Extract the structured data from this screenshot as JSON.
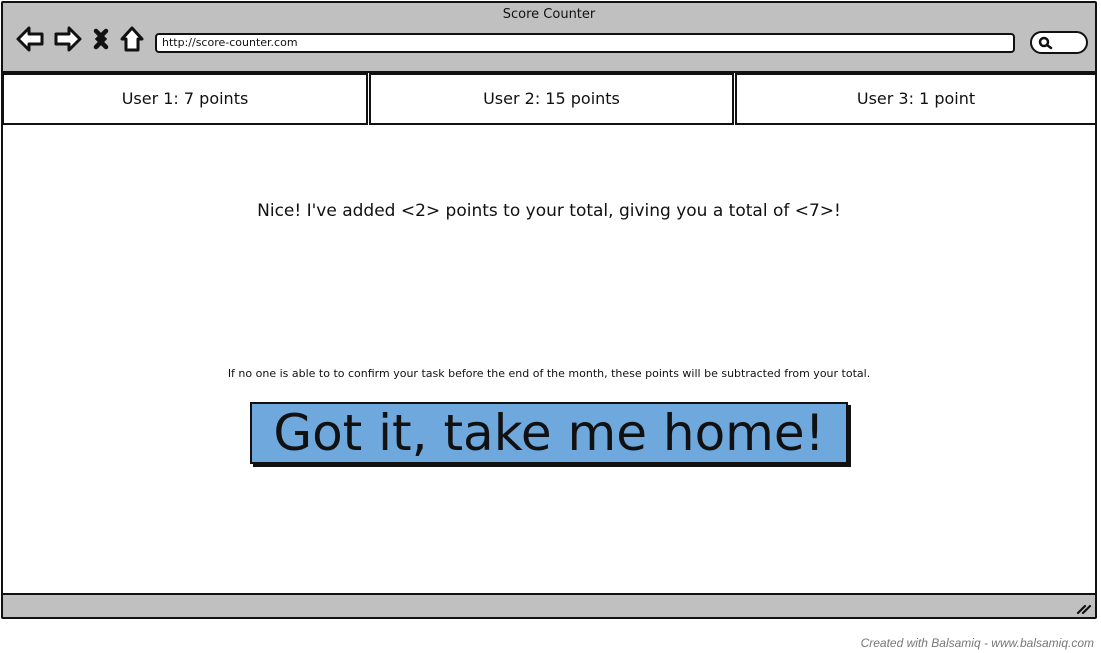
{
  "window": {
    "title": "Score Counter",
    "url": "http://score-counter.com"
  },
  "nav_icons": [
    "back-arrow-icon",
    "forward-arrow-icon",
    "close-icon",
    "home-icon"
  ],
  "search_icon": "search-icon",
  "tabs": [
    {
      "label": "User 1: 7 points"
    },
    {
      "label": "User 2: 15 points"
    },
    {
      "label": "User 3: 1 point"
    }
  ],
  "main": {
    "message": "Nice! I've added <2> points to your total, giving you a total of <7>!",
    "note": "If no one is able to to confirm your task before the end of the month, these points will be subtracted from your total.",
    "button_label": "Got it, take me home!"
  },
  "footer": {
    "credit": "Created with Balsamiq - www.balsamiq.com"
  },
  "colors": {
    "chrome": "#c0c0c0",
    "button": "#6fa8dc",
    "outline": "#111111"
  }
}
